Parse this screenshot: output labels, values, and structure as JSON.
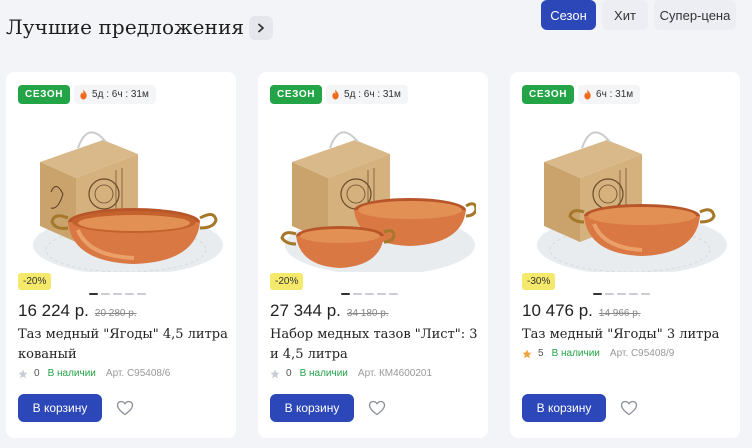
{
  "header": {
    "title": "Лучшие предложения",
    "tabs": [
      {
        "label": "Сезон",
        "active": true
      },
      {
        "label": "Хит",
        "active": false
      },
      {
        "label": "Супер-цена",
        "active": false
      }
    ]
  },
  "colors": {
    "accent": "#2b47b8",
    "season_badge": "#22a447",
    "discount_badge": "#f4e96a",
    "in_stock": "#22a447",
    "star_filled": "#f0a33a",
    "star_empty": "#c8ccd4"
  },
  "products": [
    {
      "badge": "СЕЗОН",
      "timer": "5д : 6ч : 31м",
      "discount": "-20%",
      "price": "16 224 р.",
      "old_price": "20 280 р.",
      "name": "Таз медный \"Ягоды\" 4,5 литра кованый",
      "rating": "0",
      "rating_star": "empty",
      "stock": "В наличии",
      "article": "Арт. С95408/6",
      "cart_label": "В корзину",
      "image": "single-basin"
    },
    {
      "badge": "СЕЗОН",
      "timer": "5д : 6ч : 31м",
      "discount": "-20%",
      "price": "27 344 р.",
      "old_price": "34 180 р.",
      "name": "Набор медных тазов \"Лист\": 3 и 4,5 литра",
      "rating": "0",
      "rating_star": "empty",
      "stock": "В наличии",
      "article": "Арт. КМ4600201",
      "cart_label": "В корзину",
      "image": "two-basins"
    },
    {
      "badge": "СЕЗОН",
      "timer": "6ч : 31м",
      "discount": "-30%",
      "price": "10 476 р.",
      "old_price": "14 966 р.",
      "name": "Таз медный \"Ягоды\" 3 литра",
      "rating": "5",
      "rating_star": "filled",
      "stock": "В наличии",
      "article": "Арт. С95408/9",
      "cart_label": "В корзину",
      "image": "single-basin"
    }
  ]
}
